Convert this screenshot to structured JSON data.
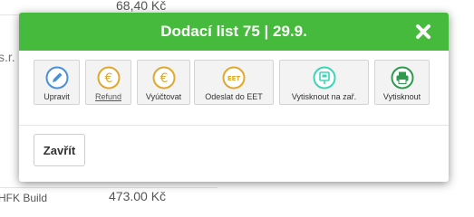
{
  "background": {
    "top_amount": "68,40 Kč",
    "left_fragment": "s.r.",
    "bottom_left_text": "HFK Build",
    "bottom_amount": "473.00 Kč"
  },
  "modal": {
    "title": "Dodací list 75 | 29.9.",
    "header_color": "#46ba3c",
    "close_icon": "close-x-icon",
    "actions": [
      {
        "label": "Upravit",
        "icon": "pencil-icon",
        "color": "#4a90d9"
      },
      {
        "label": "Refund",
        "icon": "euro-icon",
        "color": "#e0a82e"
      },
      {
        "label": "Vyúčtovat",
        "icon": "euro-icon",
        "color": "#e0a82e"
      },
      {
        "label": "Odeslat do EET",
        "icon": "eet-icon",
        "color": "#e0a82e"
      },
      {
        "label": "Vytisknout na zař.",
        "icon": "print-device-icon",
        "color": "#3cd6b4"
      },
      {
        "label": "Vytisknout",
        "icon": "printer-icon",
        "color": "#2e9a4e"
      }
    ],
    "close_button_label": "Zavřít"
  }
}
